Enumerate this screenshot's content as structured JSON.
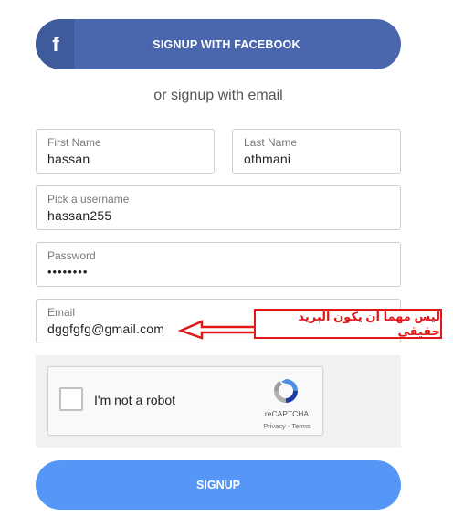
{
  "facebook_button": {
    "icon_glyph": "f",
    "label": "SIGNUP WITH FACEBOOK",
    "color": "#4a67ad"
  },
  "divider_text": "or signup with email",
  "fields": {
    "first_name": {
      "label": "First Name",
      "value": "hassan"
    },
    "last_name": {
      "label": "Last Name",
      "value": "othmani"
    },
    "username": {
      "label": "Pick a username",
      "value": "hassan255"
    },
    "password": {
      "label": "Password",
      "value": "••••••••"
    },
    "email": {
      "label": "Email",
      "value": "dggfgfg@gmail.com"
    }
  },
  "captcha": {
    "label": "I'm not a robot",
    "brand": "reCAPTCHA",
    "terms": "Privacy - Terms",
    "icon": "recaptcha-logo-icon"
  },
  "annotation": {
    "text": "ليس مهما أن يكون البريد حقيقي",
    "color": "#e01818"
  },
  "signup_button": {
    "label": "SIGNUP",
    "color": "#5596f7"
  }
}
